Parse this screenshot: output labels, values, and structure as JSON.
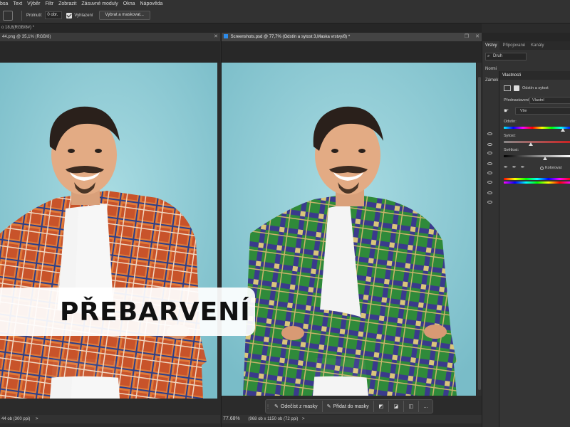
{
  "menu": [
    "bsa",
    "Text",
    "Výběr",
    "Filtr",
    "Zobrazit",
    "Zásuvné moduly",
    "Okna",
    "Nápověda"
  ],
  "options": {
    "feather_label": "Prolnutí:",
    "feather_value": "0 obr.",
    "antialias_label": "Vyhlazení",
    "select_mask_label": "Vybrat a maskovat..."
  },
  "tabs": {
    "doc_tab": "o 18,8(RGB/8#) *"
  },
  "left_doc": {
    "title": "44.png @ 35,1% (RGB/8)",
    "status_zoom": "44 ob (300 ppi)",
    "status_arrow": ">"
  },
  "right_doc": {
    "title": "Screenshots.psd @ 77,7% (Odstín a sytost 3,Maska vrstvy/8) *",
    "status_zoom": "77.68%",
    "status_info": "(968 ob x 1150 ob (72 ppi)",
    "status_arrow": ">"
  },
  "banner": {
    "text": "PŘEBARVENÍ"
  },
  "taskbar": {
    "subtract_label": "Odečíst z masky",
    "add_label": "Přidat do masky",
    "more_label": "..."
  },
  "layers_panel": {
    "tabs": [
      "Vrstvy",
      "Připojované",
      "Kanály"
    ],
    "search_placeholder": "Druh",
    "normal_label": "Normi",
    "lock_label": "Zámek"
  },
  "properties": {
    "title": "Vlastnosti",
    "layer_type": "Odstín a sytost",
    "preset_label": "Přednastavení:",
    "preset_value": "Vlastní",
    "channel_value": "Vše",
    "hue_label": "Odstín:",
    "saturation_label": "Sytost:",
    "lightness_label": "Světlost:",
    "colorize_label": "Kolorovat",
    "hue_level": 0.88,
    "saturation_level": 0.4,
    "lightness_level": 0.62
  },
  "colors": {
    "accent": "#2d8ceb",
    "panel": "#323232",
    "photo_bg": "#8ecdd6"
  }
}
